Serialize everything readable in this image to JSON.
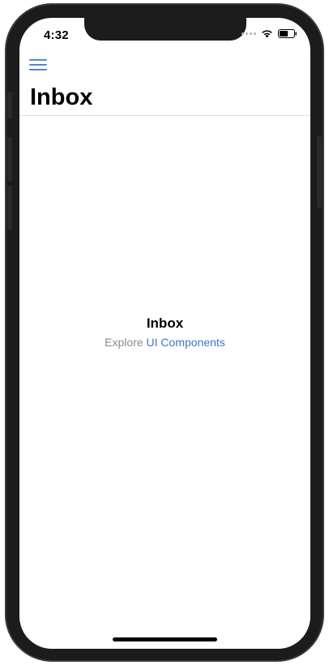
{
  "status_bar": {
    "time": "4:32",
    "wifi_icon": "wifi-icon",
    "battery_icon": "battery-icon",
    "battery_level": 0.6
  },
  "nav": {
    "menu_icon": "hamburger-menu-icon",
    "title": "Inbox"
  },
  "empty_state": {
    "title": "Inbox",
    "subtitle_prefix": "Explore ",
    "link_text": "UI Components"
  },
  "colors": {
    "accent": "#3b76d6",
    "muted_text": "#8a8a8a",
    "divider": "#dcdcdc",
    "device_frame": "#1c1c1c"
  }
}
